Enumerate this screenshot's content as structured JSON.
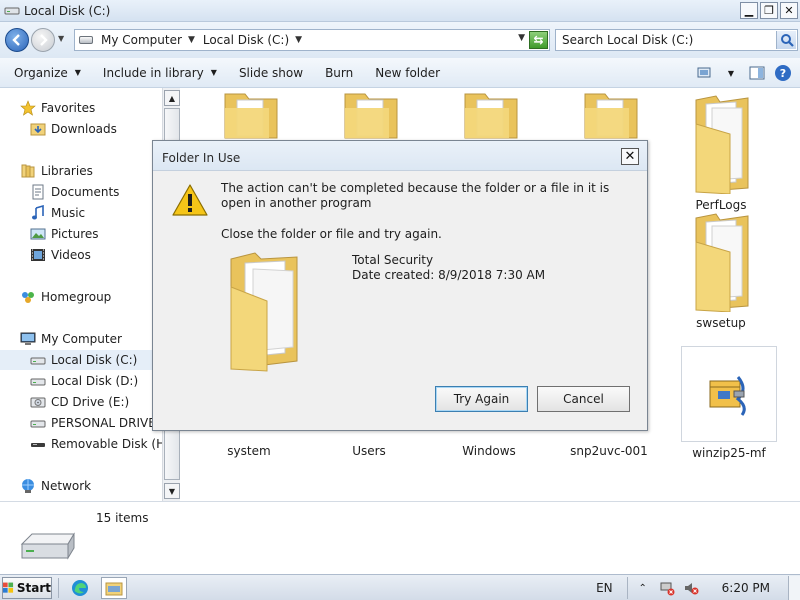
{
  "window": {
    "title": "Local Disk (C:)",
    "minimize_glyph": "▁",
    "maximize_glyph": "❐",
    "close_glyph": "✕"
  },
  "address": {
    "crumbs": [
      "My Computer",
      "Local Disk (C:)"
    ],
    "search_placeholder": "Search Local Disk (C:)"
  },
  "toolbar": {
    "organize": "Organize",
    "include_in_library": "Include in library",
    "slide_show": "Slide show",
    "burn": "Burn",
    "new_folder": "New folder"
  },
  "nav": {
    "favorites": "Favorites",
    "downloads": "Downloads",
    "libraries": "Libraries",
    "documents": "Documents",
    "music": "Music",
    "pictures": "Pictures",
    "videos": "Videos",
    "homegroup": "Homegroup",
    "my_computer": "My Computer",
    "local_c": "Local Disk (C:)",
    "local_d": "Local Disk (D:)",
    "cd_drive": "CD Drive (E:)",
    "personal_drive": "PERSONAL DRIVE  (",
    "removable": "Removable Disk (H:)",
    "network": "Network"
  },
  "files": {
    "perflogs": "PerfLogs",
    "swsetup": "swsetup",
    "system": "system",
    "users": "Users",
    "windows": "Windows",
    "snp2uvc": "snp2uvc-001",
    "winzip": "winzip25-mf"
  },
  "details": {
    "item_count": "15 items"
  },
  "dialog": {
    "title": "Folder In Use",
    "close_glyph": "✕",
    "message": "The action can't be completed because the folder or a file in it is open in another program",
    "instruction": "Close the folder or file and try again.",
    "item_name": "Total Security",
    "item_date": "Date created: 8/9/2018 7:30 AM",
    "try_again": "Try Again",
    "cancel": "Cancel"
  },
  "taskbar": {
    "start": "Start",
    "language": "EN",
    "clock": "6:20 PM"
  },
  "colors": {
    "accent": "#2b64b8",
    "folder_yellow": "#f3d77a",
    "selection": "#e5eef8"
  }
}
